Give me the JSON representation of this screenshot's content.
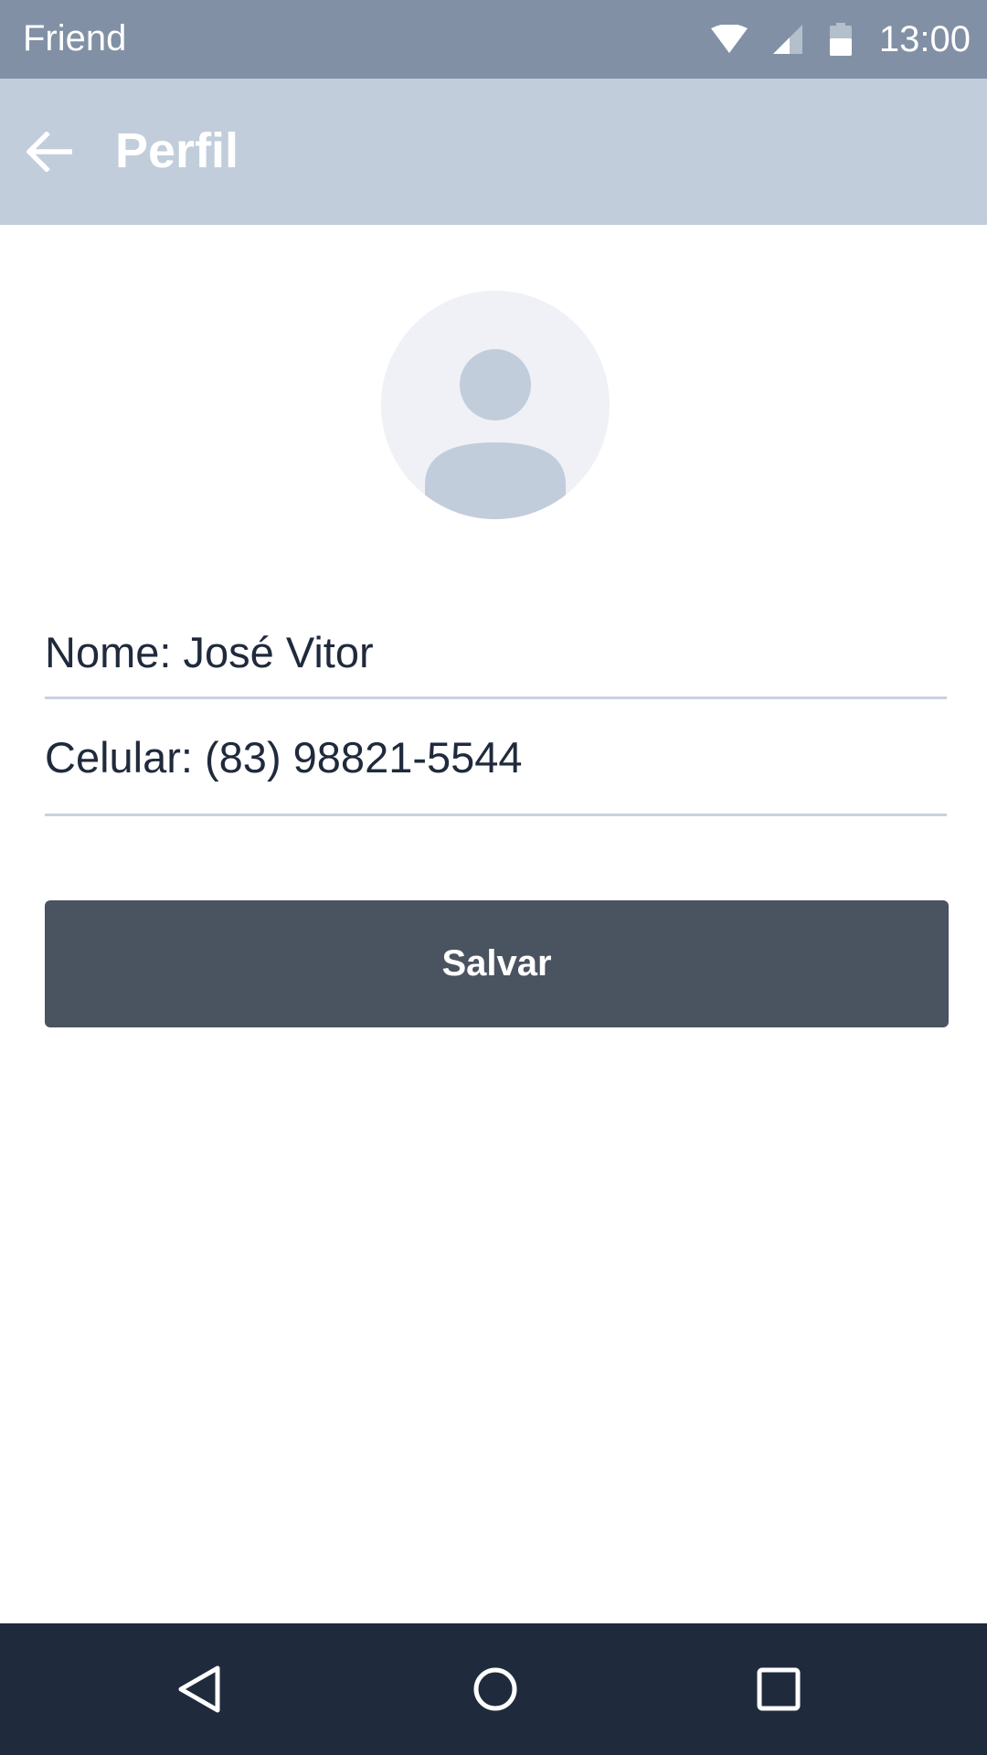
{
  "status_bar": {
    "app_name": "Friend",
    "time": "13:00",
    "icons": [
      "wifi-icon",
      "signal-icon",
      "battery-icon"
    ]
  },
  "app_bar": {
    "title": "Perfil",
    "back_icon": "arrow-left-icon"
  },
  "profile": {
    "avatar_icon": "person-placeholder-icon",
    "name_field": "Nome: José Vitor",
    "phone_field": "Celular: (83) 98821-5544"
  },
  "actions": {
    "save_label": "Salvar"
  },
  "nav_bar": {
    "icons": [
      "nav-back-icon",
      "nav-home-icon",
      "nav-recents-icon"
    ]
  },
  "colors": {
    "status_bar": "#8190a5",
    "app_bar": "#c1cdda",
    "button": "#4a5360",
    "nav_bar": "#1f2b3c",
    "text": "#1f2a3c",
    "avatar_bg": "#eff1f6",
    "avatar_fg": "#c1cdda"
  }
}
